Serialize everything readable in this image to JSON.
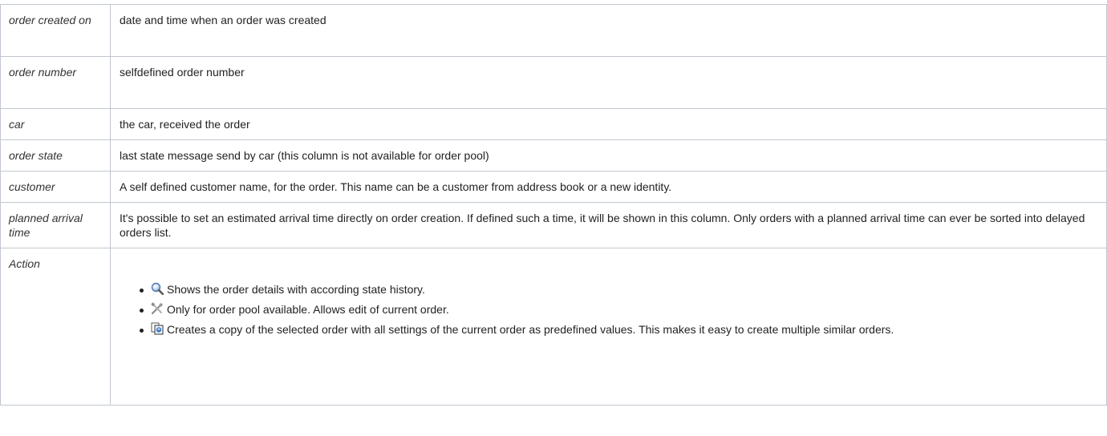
{
  "table": {
    "rows": [
      {
        "term": "order created on",
        "description": "date and time when an order was created"
      },
      {
        "term": "order number",
        "description": "selfdefined order number"
      },
      {
        "term": "car",
        "description": "the car, received the order"
      },
      {
        "term": "order state",
        "description": "last state message send by car (this column is not available for order pool)"
      },
      {
        "term": "customer",
        "description": "A self defined customer name, for the order. This name can be a customer from address book or a new identity."
      },
      {
        "term": "planned arrival time",
        "description": "It's possible to set an estimated arrival time directly on order creation. If defined such a time, it will be shown in this column. Only orders with a planned arrival time can ever be sorted into delayed orders list."
      },
      {
        "term": "Action",
        "description": ""
      }
    ],
    "actions": [
      {
        "icon": "magnifier-icon",
        "text": "Shows the order details with according state history."
      },
      {
        "icon": "tools-icon",
        "text": "Only for order pool available. Allows edit of current order."
      },
      {
        "icon": "copy-order-icon",
        "text": "Creates a copy of the selected order with all settings of the current order as predefined values. This makes it easy to create multiple similar orders."
      }
    ]
  }
}
